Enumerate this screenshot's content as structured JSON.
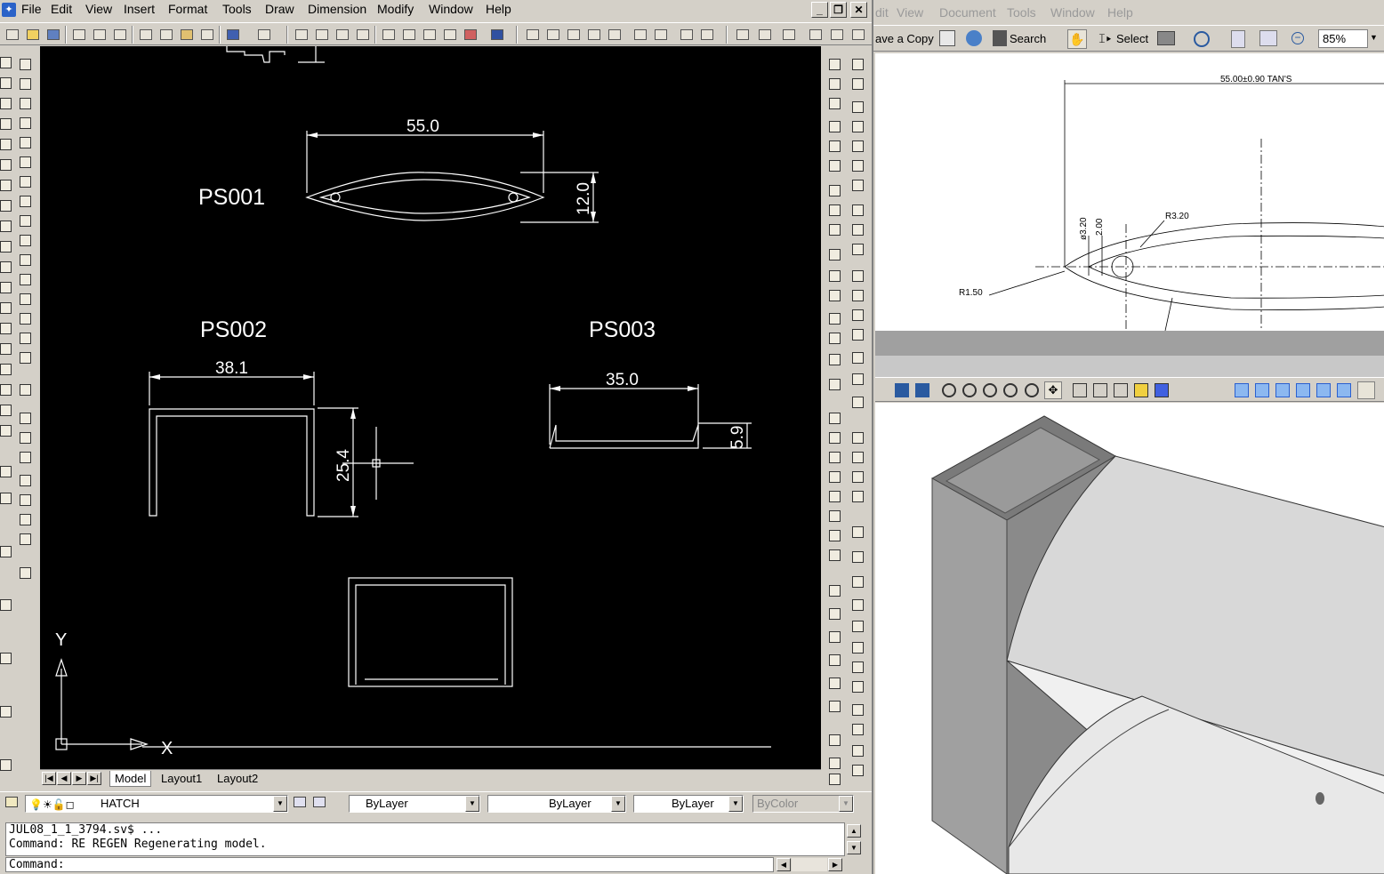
{
  "cad": {
    "menu": [
      "File",
      "Edit",
      "View",
      "Insert",
      "Format",
      "Tools",
      "Draw",
      "Dimension",
      "Modify",
      "Window",
      "Help"
    ],
    "window_buttons": {
      "minimize": "_",
      "restore": "❐",
      "close": "✕"
    },
    "drawing": {
      "labels": {
        "ps001": "PS001",
        "ps002": "PS002",
        "ps003": "PS003"
      },
      "dimensions": {
        "ps001_width": "55.0",
        "ps001_height": "12.0",
        "ps002_width": "38.1",
        "ps002_height": "25.4",
        "ps003_width": "35.0",
        "ps003_height": "5.9"
      },
      "ucs": {
        "y": "Y",
        "x": "X"
      }
    },
    "tabs": [
      "Model",
      "Layout1",
      "Layout2"
    ],
    "properties": {
      "layer": "HATCH",
      "color": "ByLayer",
      "linetype": "ByLayer",
      "lineweight": "ByLayer",
      "plotstyle": "ByColor"
    },
    "command_history": [
      "JUL08_1_1_3794.sv$ ...",
      "Command: RE REGEN Regenerating model."
    ],
    "command_prompt": "Command:"
  },
  "pdf": {
    "menu": [
      "dit",
      "View",
      "Document",
      "Tools",
      "Window",
      "Help"
    ],
    "toolbar": {
      "save_copy": "ave a Copy",
      "search": "Search",
      "select": "Select",
      "zoom": "85%"
    },
    "drawing_annotations": {
      "overall": "55.00±0.90  TAN'S",
      "r320": "R3.20",
      "r150": "R1.50",
      "d320": "ø3.20",
      "d200": "2.00"
    }
  },
  "colors": {
    "canvas": "#000000",
    "chrome": "#d4d0c8",
    "pdf_doc": "#ffffff"
  }
}
